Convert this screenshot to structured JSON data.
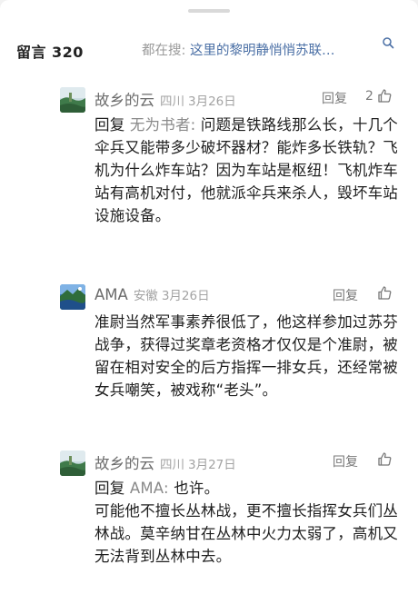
{
  "header": {
    "title": "留言",
    "count": "320",
    "search_prefix": "都在搜:",
    "search_query": "这里的黎明静悄悄苏联…"
  },
  "comments": [
    {
      "author": "故乡的云",
      "location": "四川",
      "date": "3月26日",
      "reply_label": "回复",
      "likes": "2",
      "reply_prefix": "回复",
      "reply_to": "无为书者:",
      "text": "问题是铁路线那么长，十几个伞兵又能带多少破坏器材？能炸多长铁轨？飞机为什么炸车站？因为车站是枢纽！飞机炸车站有高机对付，他就派伞兵来杀人，毁坏车站设施设备。"
    },
    {
      "author": "AMA",
      "location": "安徽",
      "date": "3月26日",
      "reply_label": "回复",
      "likes": "",
      "text": "准尉当然军事素养很低了，他这样参加过苏芬战争，获得过奖章老资格才仅仅是个准尉，被留在相对安全的后方指挥一排女兵，还经常被女兵嘲笑，被戏称“老头”。"
    },
    {
      "author": "故乡的云",
      "location": "四川",
      "date": "3月27日",
      "reply_label": "回复",
      "likes": "",
      "reply_prefix": "回复",
      "reply_to": "AMA:",
      "reply_text": "也许。",
      "text": "可能他不擅长丛林战，更不擅长指挥女兵们丛林战。莫辛纳甘在丛林中火力太弱了，高机又无法背到丛林中去。"
    }
  ]
}
